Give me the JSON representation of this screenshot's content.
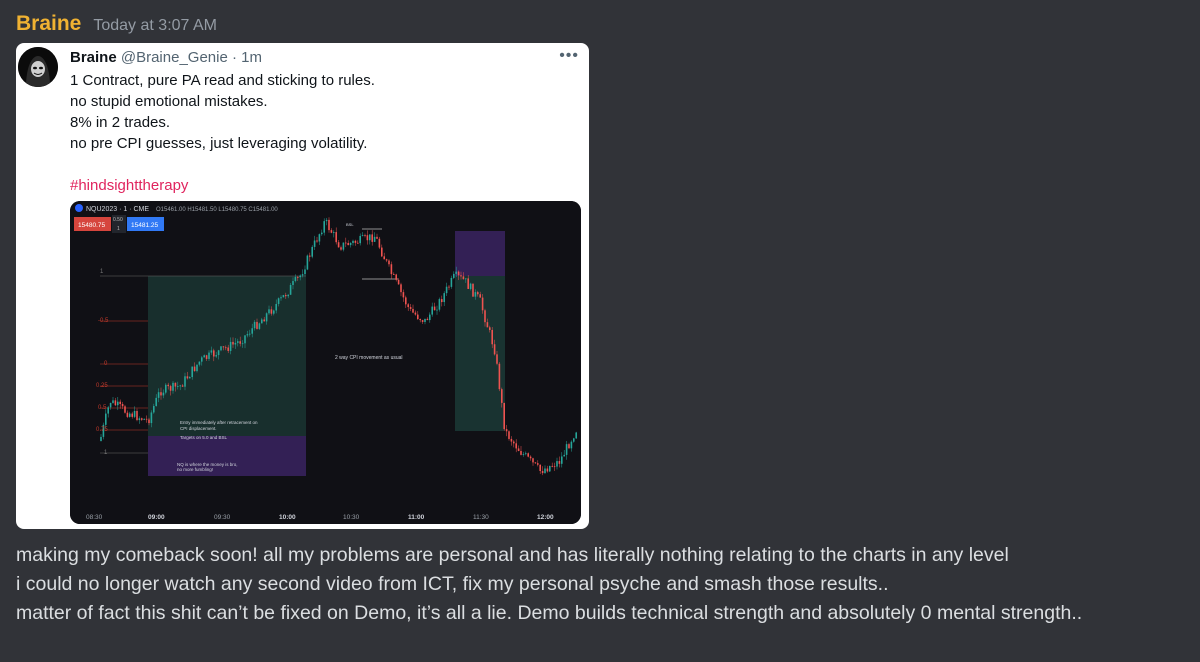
{
  "message": {
    "author": "Braine",
    "timestamp": "Today at 3:07 AM",
    "author_color": "#f0b232",
    "lines": [
      "making my comeback soon!  all my problems are personal and has literally nothing relating to the charts in any level",
      "i could no longer watch any second video from ICT, fix my personal psyche and smash those results..",
      "matter of fact this shit can’t be fixed on Demo, it’s all a lie. Demo builds technical strength and absolutely 0 mental strength.."
    ]
  },
  "tweet": {
    "name": "Braine",
    "handle": "@Braine_Genie",
    "separator": "·",
    "time": "1m",
    "more_icon": "ellipsis-icon",
    "lines": [
      "1 Contract, pure PA read and sticking to rules.",
      "no stupid emotional mistakes.",
      "8% in 2 trades.",
      "no pre CPI guesses, just leveraging volatility."
    ],
    "hashtag": "#hindsighttherapy",
    "hashtag_color": "#e0245e",
    "chart": {
      "symbol": "NQU2023 · 1 · CME",
      "ohlc": "O15461.00 H15481.50 L15480.75 C15481.00",
      "sell_price": "15480.75",
      "spread": "0.50",
      "qty": "1",
      "buy_price": "15481.25",
      "fib_labels": [
        "1",
        "-0.5",
        "0",
        "0.25",
        "0.5",
        "0.75",
        "1"
      ],
      "time_labels": [
        "08:30",
        "09:00",
        "09:30",
        "10:00",
        "10:30",
        "11:00",
        "11:30",
        "12:00"
      ],
      "annotations": {
        "cpi": "2 way CPI movement as usual",
        "entry1": "Entry immediately after retracement on",
        "entry2": "CPI displacement.",
        "targets": "Targets on 5.0 and BSL",
        "nq1": "NQ is where the money is bro,",
        "nq2": "no more fumbling!",
        "top": "BSL"
      }
    }
  }
}
